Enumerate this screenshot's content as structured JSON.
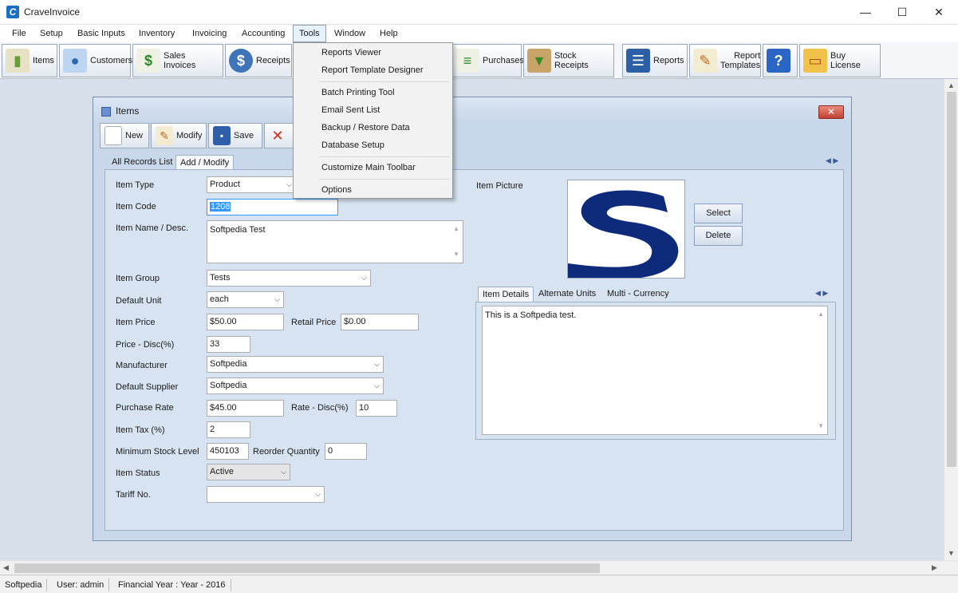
{
  "window": {
    "title": "CraveInvoice",
    "minimize": "—",
    "maximize": "☐",
    "close": "✕"
  },
  "menu": [
    "File",
    "Setup",
    "Basic Inputs",
    "Inventory",
    "Invoicing",
    "Accounting",
    "Tools",
    "Window",
    "Help"
  ],
  "tools_menu": {
    "items": [
      "Reports Viewer",
      "Report Template Designer",
      "Batch Printing Tool",
      "Email Sent List",
      "Backup / Restore Data",
      "Database Setup",
      "Customize Main Toolbar",
      "Options"
    ]
  },
  "toolbar": {
    "items": "Items",
    "customers": "Customers",
    "sales_invoices": "Sales Invoices",
    "receipts": "Receipts",
    "purchases": "Purchases",
    "stock_receipts": "Stock Receipts",
    "reports": "Reports",
    "report_templates_1": "Report",
    "report_templates_2": "Templates",
    "buy_license": "Buy License"
  },
  "child": {
    "title": "Items",
    "toolbar": {
      "new": "New",
      "modify": "Modify",
      "save": "Save"
    },
    "tabs": [
      "All Records List",
      "Add / Modify"
    ],
    "form": {
      "item_type_label": "Item Type",
      "item_type": "Product",
      "item_code_label": "Item Code",
      "item_code": "1208",
      "item_name_label": "Item Name / Desc.",
      "item_name": "Softpedia Test",
      "item_group_label": "Item Group",
      "item_group": "Tests",
      "default_unit_label": "Default Unit",
      "default_unit": "each",
      "item_price_label": "Item Price",
      "item_price": "$50.00",
      "retail_price_label": "Retail Price",
      "retail_price": "$0.00",
      "price_disc_label": "Price - Disc(%)",
      "price_disc": "33",
      "manufacturer_label": "Manufacturer",
      "manufacturer": "Softpedia",
      "default_supplier_label": "Default Supplier",
      "default_supplier": "Softpedia",
      "purchase_rate_label": "Purchase Rate",
      "purchase_rate": "$45.00",
      "rate_disc_label": "Rate - Disc(%)",
      "rate_disc": "10",
      "item_tax_label": "Item Tax (%)",
      "item_tax": "2",
      "min_stock_label": "Minimum Stock Level",
      "min_stock": "450103",
      "reorder_label": "Reorder Quantity",
      "reorder": "0",
      "item_status_label": "Item Status",
      "item_status": "Active",
      "tariff_label": "Tariff No.",
      "tariff": ""
    },
    "picture": {
      "label": "Item Picture",
      "select": "Select",
      "delete": "Delete"
    },
    "detail_tabs": [
      "Item Details",
      "Alternate Units",
      "Multi - Currency"
    ],
    "details_text": "This is a Softpedia test."
  },
  "status": {
    "company": "Softpedia",
    "user": "User: admin",
    "year": "Financial Year : Year - 2016"
  }
}
